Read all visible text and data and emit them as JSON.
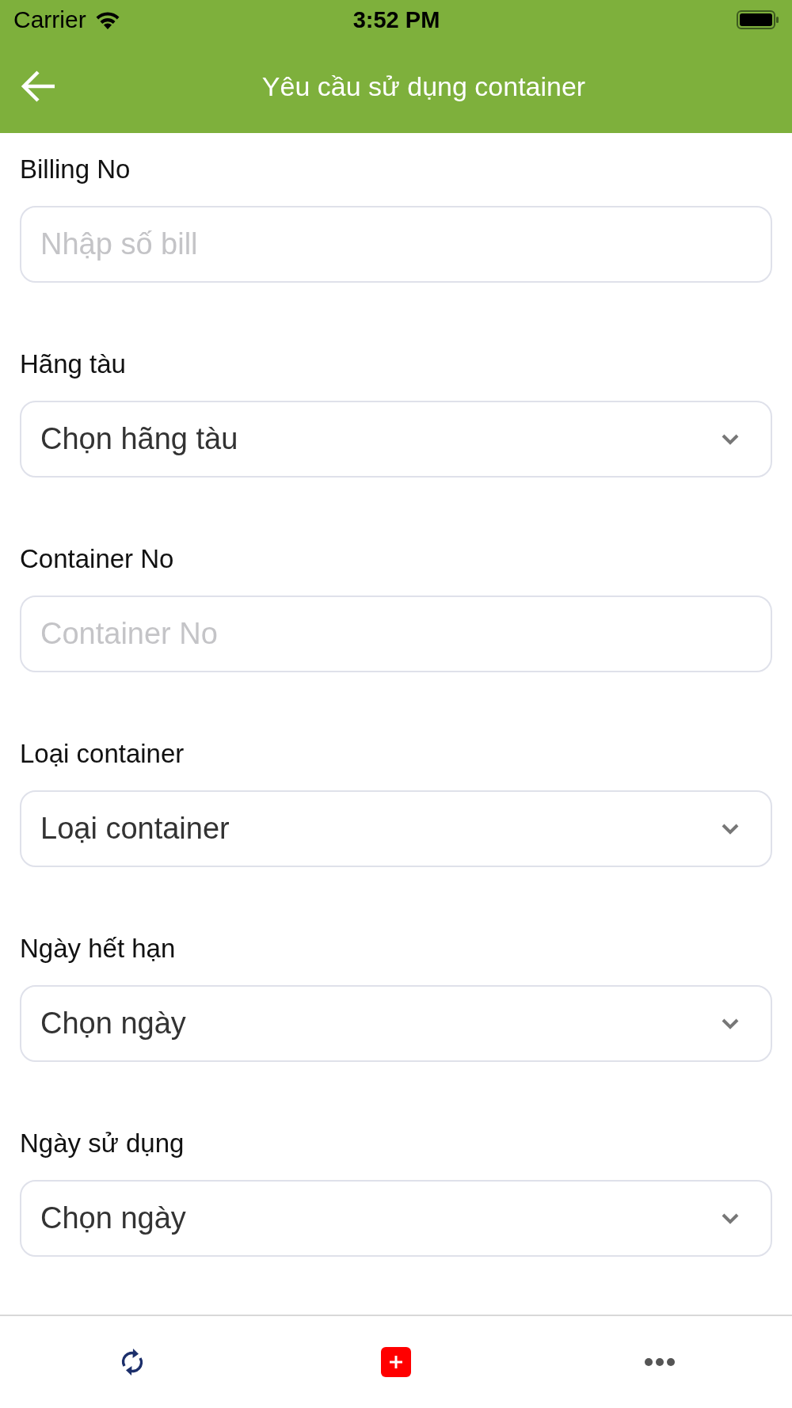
{
  "status_bar": {
    "carrier": "Carrier",
    "time": "3:52 PM"
  },
  "header": {
    "title": "Yêu cầu sử dụng container"
  },
  "form": {
    "fields": [
      {
        "label": "Billing No",
        "kind": "text",
        "placeholder": "Nhập số bill"
      },
      {
        "label": "Hãng tàu",
        "kind": "select",
        "value": "Chọn hãng tàu"
      },
      {
        "label": "Container No",
        "kind": "text",
        "placeholder": "Container No"
      },
      {
        "label": "Loại container",
        "kind": "select",
        "value": "Loại container"
      },
      {
        "label": "Ngày hết hạn",
        "kind": "select",
        "value": "Chọn ngày"
      },
      {
        "label": "Ngày sử dụng",
        "kind": "select",
        "value": "Chọn ngày"
      }
    ]
  },
  "toolbar": {
    "items": [
      {
        "kind": "refresh"
      },
      {
        "kind": "add"
      },
      {
        "kind": "more"
      }
    ]
  }
}
